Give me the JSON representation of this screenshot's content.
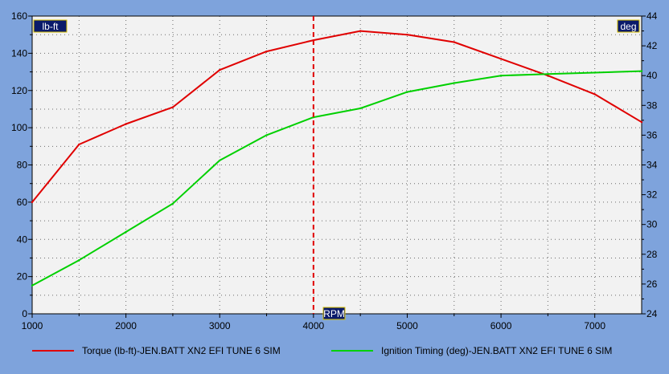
{
  "chart_data": {
    "type": "line",
    "x_axis": {
      "label": "RPM",
      "range": [
        1000,
        7500
      ],
      "ticks": [
        1000,
        2000,
        3000,
        4000,
        5000,
        6000,
        7000
      ]
    },
    "y_left": {
      "label": "lb-ft",
      "range": [
        0,
        160
      ],
      "ticks": [
        0,
        20,
        40,
        60,
        80,
        100,
        120,
        140,
        160
      ]
    },
    "y_right": {
      "label": "deg",
      "range": [
        24,
        44
      ],
      "ticks": [
        24,
        26,
        28,
        30,
        32,
        34,
        36,
        38,
        40,
        42,
        44
      ]
    },
    "cursor_x": 4000,
    "grid": true,
    "legend_position": "bottom",
    "series": [
      {
        "name": "Torque (lb-ft)-JEN.BATT XN2 EFI TUNE 6 SIM",
        "axis": "left",
        "color": "#e00000",
        "x": [
          1000,
          1500,
          2000,
          2500,
          3000,
          3500,
          4000,
          4500,
          5000,
          5500,
          6000,
          6500,
          7000,
          7500
        ],
        "y": [
          60,
          91,
          102,
          111,
          131,
          141,
          147,
          152,
          150,
          146,
          137,
          128,
          118,
          103
        ]
      },
      {
        "name": "Ignition Timing (deg)-JEN.BATT XN2 EFI TUNE 6 SIM",
        "axis": "right",
        "color": "#00d000",
        "x": [
          1000,
          1500,
          2000,
          2500,
          3000,
          3500,
          4000,
          4500,
          5000,
          5500,
          6000,
          6500,
          7000,
          7500
        ],
        "y": [
          25.9,
          27.6,
          29.5,
          31.4,
          34.3,
          36.0,
          37.2,
          37.8,
          38.9,
          39.5,
          40.0,
          40.1,
          40.2,
          40.3
        ]
      }
    ]
  }
}
